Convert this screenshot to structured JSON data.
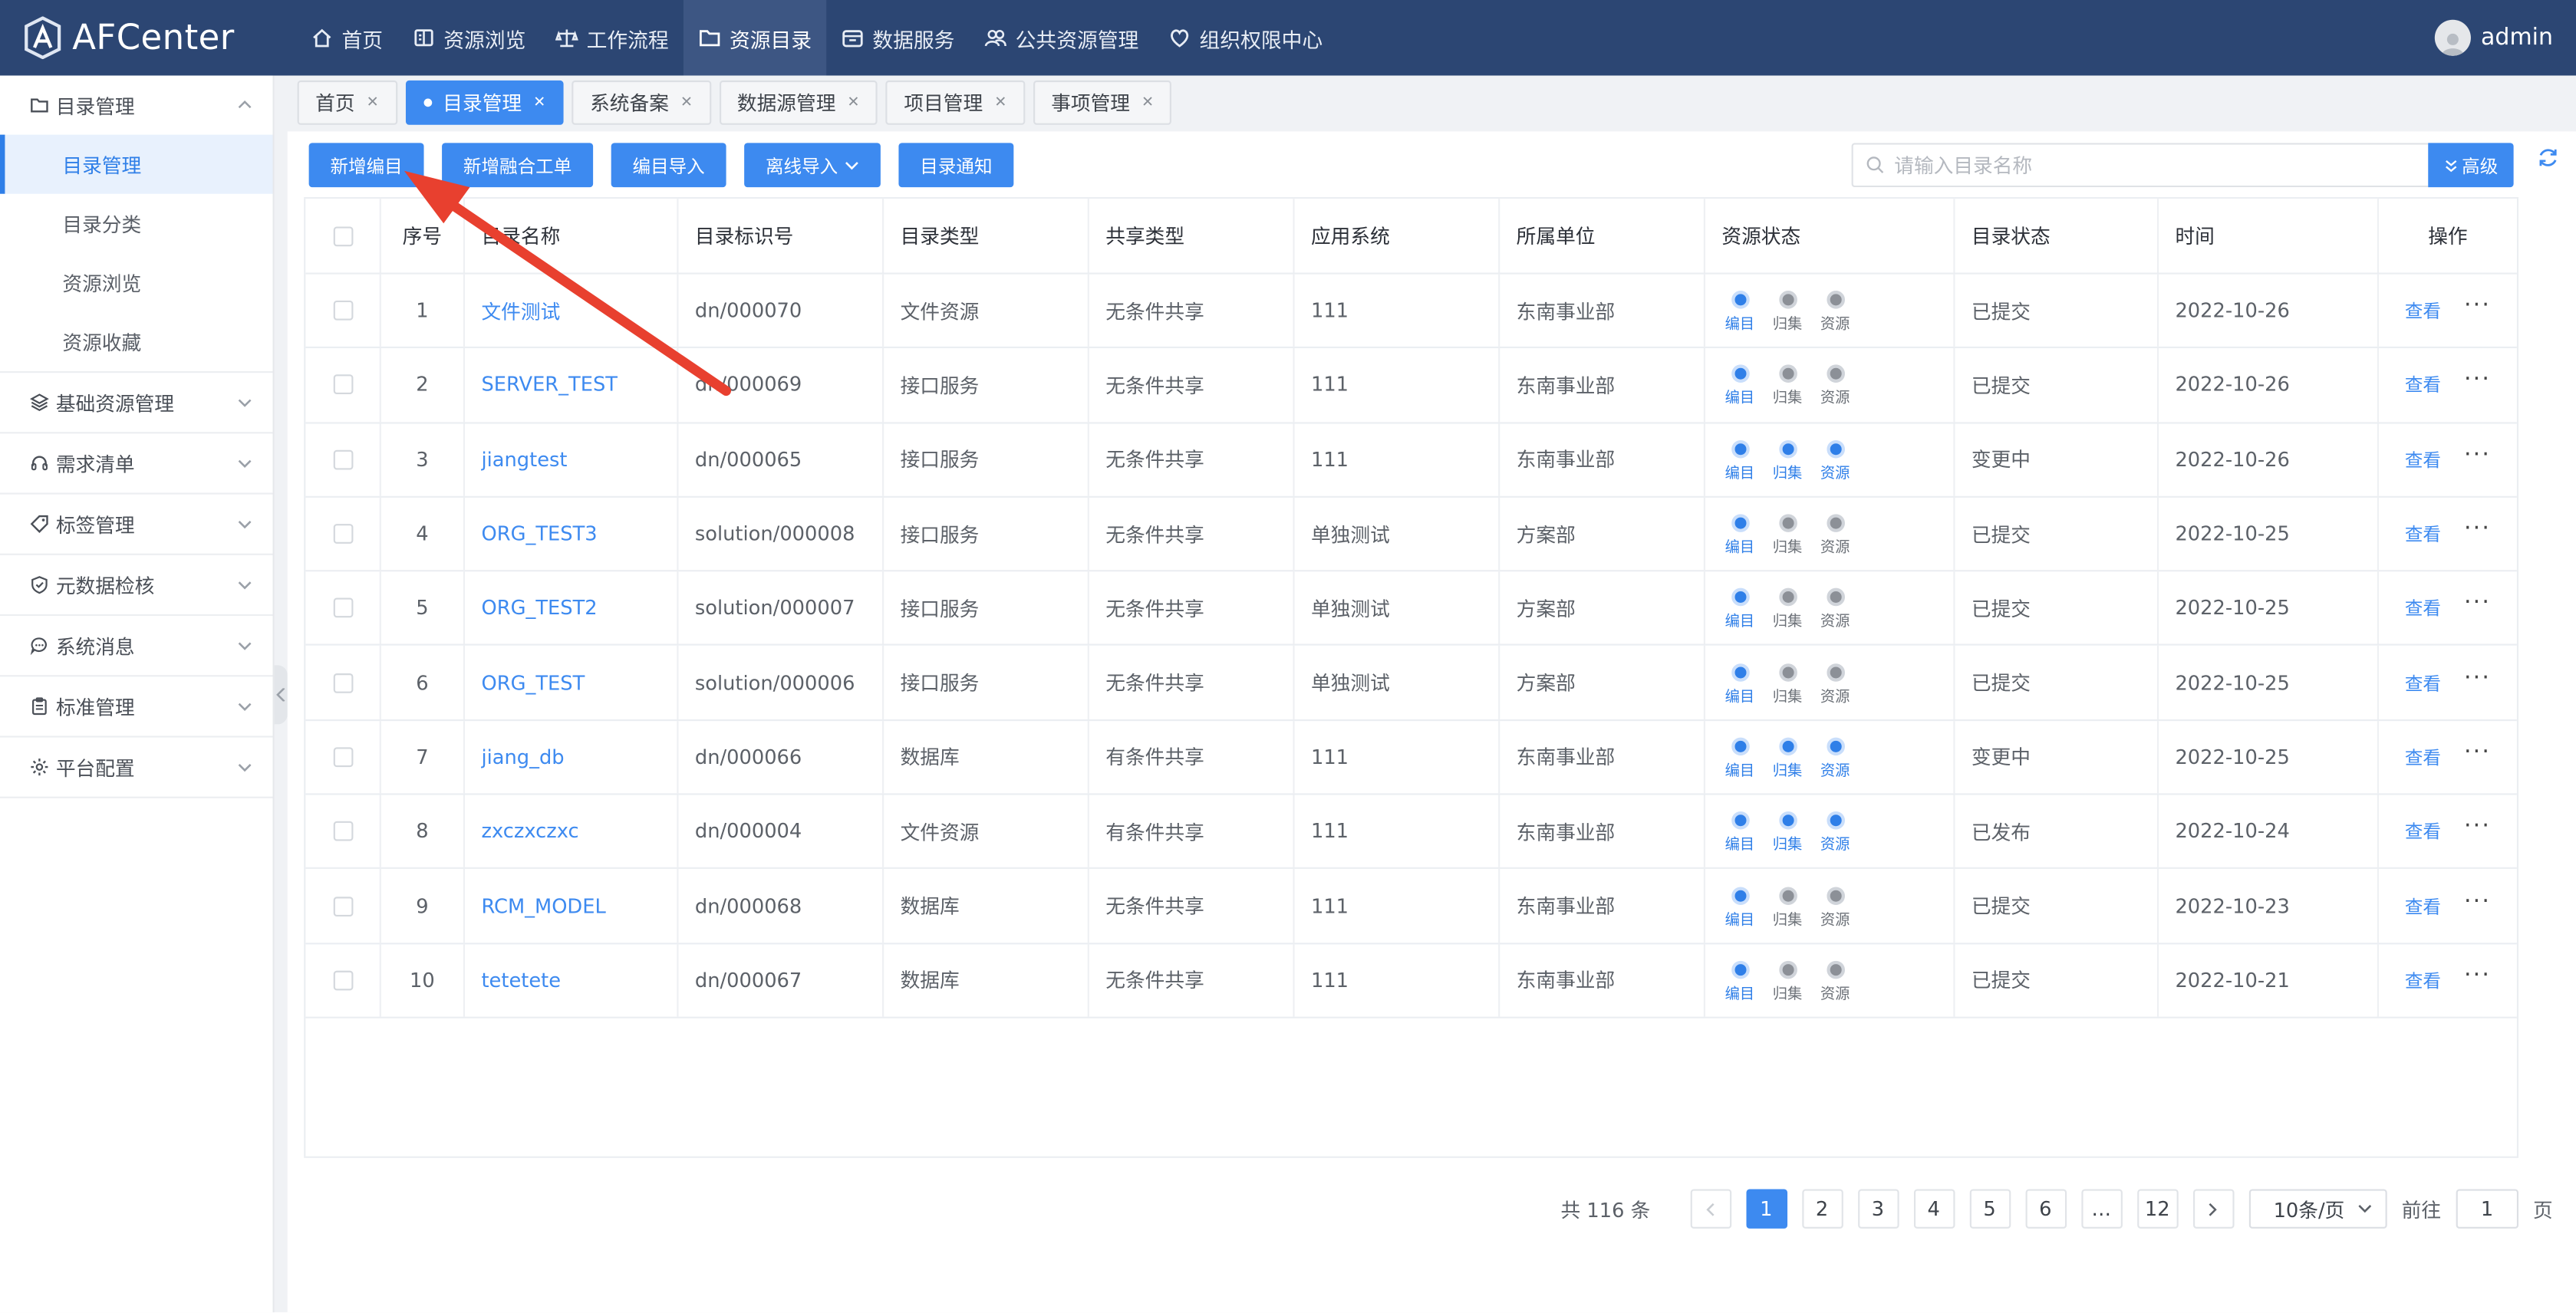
{
  "app": {
    "name": "AFCenter",
    "user": "admin"
  },
  "nav": [
    {
      "label": "首页",
      "icon": "home-icon"
    },
    {
      "label": "资源浏览",
      "icon": "browse-icon"
    },
    {
      "label": "工作流程",
      "icon": "scale-icon"
    },
    {
      "label": "资源目录",
      "icon": "folder-icon",
      "active": true
    },
    {
      "label": "数据服务",
      "icon": "data-service-icon"
    },
    {
      "label": "公共资源管理",
      "icon": "users-icon"
    },
    {
      "label": "组织权限中心",
      "icon": "heart-shield-icon"
    }
  ],
  "sidebar": {
    "groups": [
      {
        "label": "目录管理",
        "icon": "folder-icon",
        "expanded": true,
        "items": [
          {
            "label": "目录管理",
            "active": true
          },
          {
            "label": "目录分类"
          },
          {
            "label": "资源浏览"
          },
          {
            "label": "资源收藏"
          }
        ]
      },
      {
        "label": "基础资源管理",
        "icon": "layers-icon"
      },
      {
        "label": "需求清单",
        "icon": "headset-icon"
      },
      {
        "label": "标签管理",
        "icon": "tag-icon"
      },
      {
        "label": "元数据检核",
        "icon": "shield-check-icon"
      },
      {
        "label": "系统消息",
        "icon": "chat-icon"
      },
      {
        "label": "标准管理",
        "icon": "clipboard-icon"
      },
      {
        "label": "平台配置",
        "icon": "gear-icon"
      }
    ]
  },
  "tabs": [
    {
      "label": "首页"
    },
    {
      "label": "目录管理",
      "active": true
    },
    {
      "label": "系统备案"
    },
    {
      "label": "数据源管理"
    },
    {
      "label": "项目管理"
    },
    {
      "label": "事项管理"
    }
  ],
  "toolbar": {
    "new_catalog": "新增编目",
    "new_merge": "新增融合工单",
    "import_catalog": "编目导入",
    "offline_import": "离线导入",
    "notify": "目录通知"
  },
  "search": {
    "placeholder": "请输入目录名称",
    "advanced": "高级"
  },
  "table": {
    "headers": [
      "序号",
      "目录名称",
      "目录标识号",
      "目录类型",
      "共享类型",
      "应用系统",
      "所属单位",
      "资源状态",
      "目录状态",
      "时间",
      "操作"
    ],
    "status_labels": [
      "编目",
      "归集",
      "资源"
    ],
    "view_label": "查看",
    "rows": [
      {
        "no": "1",
        "name": "文件测试",
        "id": "dn/000070",
        "type": "文件资源",
        "share": "无条件共享",
        "system": "111",
        "unit": "东南事业部",
        "status": [
          1,
          0,
          0
        ],
        "state": "已提交",
        "date": "2022-10-26"
      },
      {
        "no": "2",
        "name": "SERVER_TEST",
        "id": "dn/000069",
        "type": "接口服务",
        "share": "无条件共享",
        "system": "111",
        "unit": "东南事业部",
        "status": [
          1,
          0,
          0
        ],
        "state": "已提交",
        "date": "2022-10-26"
      },
      {
        "no": "3",
        "name": "jiangtest",
        "id": "dn/000065",
        "type": "接口服务",
        "share": "无条件共享",
        "system": "111",
        "unit": "东南事业部",
        "status": [
          1,
          1,
          1
        ],
        "state": "变更中",
        "date": "2022-10-26"
      },
      {
        "no": "4",
        "name": "ORG_TEST3",
        "id": "solution/000008",
        "type": "接口服务",
        "share": "无条件共享",
        "system": "单独测试",
        "unit": "方案部",
        "status": [
          1,
          0,
          0
        ],
        "state": "已提交",
        "date": "2022-10-25"
      },
      {
        "no": "5",
        "name": "ORG_TEST2",
        "id": "solution/000007",
        "type": "接口服务",
        "share": "无条件共享",
        "system": "单独测试",
        "unit": "方案部",
        "status": [
          1,
          0,
          0
        ],
        "state": "已提交",
        "date": "2022-10-25"
      },
      {
        "no": "6",
        "name": "ORG_TEST",
        "id": "solution/000006",
        "type": "接口服务",
        "share": "无条件共享",
        "system": "单独测试",
        "unit": "方案部",
        "status": [
          1,
          0,
          0
        ],
        "state": "已提交",
        "date": "2022-10-25"
      },
      {
        "no": "7",
        "name": "jiang_db",
        "id": "dn/000066",
        "type": "数据库",
        "share": "有条件共享",
        "system": "111",
        "unit": "东南事业部",
        "status": [
          1,
          1,
          1
        ],
        "state": "变更中",
        "date": "2022-10-25"
      },
      {
        "no": "8",
        "name": "zxczxczxc",
        "id": "dn/000004",
        "type": "文件资源",
        "share": "有条件共享",
        "system": "111",
        "unit": "东南事业部",
        "status": [
          1,
          1,
          1
        ],
        "state": "已发布",
        "date": "2022-10-24"
      },
      {
        "no": "9",
        "name": "RCM_MODEL",
        "id": "dn/000068",
        "type": "数据库",
        "share": "无条件共享",
        "system": "111",
        "unit": "东南事业部",
        "status": [
          1,
          0,
          0
        ],
        "state": "已提交",
        "date": "2022-10-23"
      },
      {
        "no": "10",
        "name": "tetetete",
        "id": "dn/000067",
        "type": "数据库",
        "share": "无条件共享",
        "system": "111",
        "unit": "东南事业部",
        "status": [
          1,
          0,
          0
        ],
        "state": "已提交",
        "date": "2022-10-21"
      }
    ]
  },
  "pagination": {
    "total": "共 116 条",
    "pages": [
      "1",
      "2",
      "3",
      "4",
      "5",
      "6",
      "…",
      "12"
    ],
    "current": "1",
    "page_size": "10条/页",
    "goto_label": "前往",
    "goto_value": "1",
    "page_suffix": "页"
  },
  "colors": {
    "topbar": "#2c4673",
    "primary": "#3d8af0",
    "annotation_arrow": "#e8402f"
  }
}
